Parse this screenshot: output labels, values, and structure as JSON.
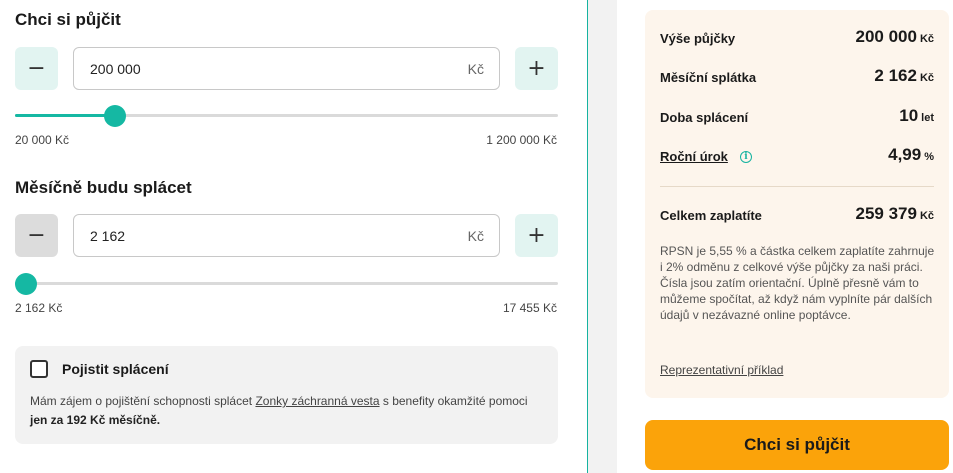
{
  "loan": {
    "title": "Chci si půjčit",
    "value": "200 000",
    "unit": "Kč",
    "minus": "−",
    "plus": "+",
    "slider_fraction": 0.17,
    "min_label": "20 000 Kč",
    "max_label": "1 200 000 Kč"
  },
  "monthly": {
    "title": "Měsíčně budu splácet",
    "value": "2 162",
    "unit": "Kč",
    "minus": "−",
    "plus": "+",
    "slider_fraction": 0.0,
    "min_label": "2 162 Kč",
    "max_label": "17 455 Kč"
  },
  "insurance": {
    "title": "Pojistit splácení",
    "checked": false,
    "text_before": "Mám zájem o pojištění schopnosti splácet ",
    "link": "Zonky záchranná vesta",
    "text_middle": " s benefity okamžité pomoci ",
    "text_bold": "jen za 192 Kč měsíčně."
  },
  "summary": {
    "loan_amount": {
      "label": "Výše půjčky",
      "value": "200 000",
      "unit": "Kč"
    },
    "monthly_payment": {
      "label": "Měsíční splátka",
      "value": "2 162",
      "unit": "Kč"
    },
    "duration": {
      "label": "Doba splácení",
      "value": "10",
      "unit": "let"
    },
    "interest": {
      "label": "Roční úrok",
      "value": "4,99",
      "unit": "%",
      "info_icon": "i"
    },
    "total": {
      "label": "Celkem zaplatíte",
      "value": "259 379",
      "unit": "Kč"
    },
    "rpsn_text": "RPSN je 5,55 % a částka celkem zaplatíte zahrnuje i 2% odměnu z celkové výše půjčky za naši práci. Čísla jsou zatím orientační. Úplně přesně vám to můžeme spočítat, až když nám vyplníte pár dalších údajů v nezávazné online poptávce.",
    "representative_link": "Reprezentativní příklad"
  },
  "cta": {
    "label": "Chci si půjčit"
  },
  "colors": {
    "accent": "#15b8a3",
    "cta": "#fba30a",
    "card": "#fdf5ec"
  },
  "icons": {
    "info": "info-icon",
    "checkbox": "checkbox-icon"
  }
}
